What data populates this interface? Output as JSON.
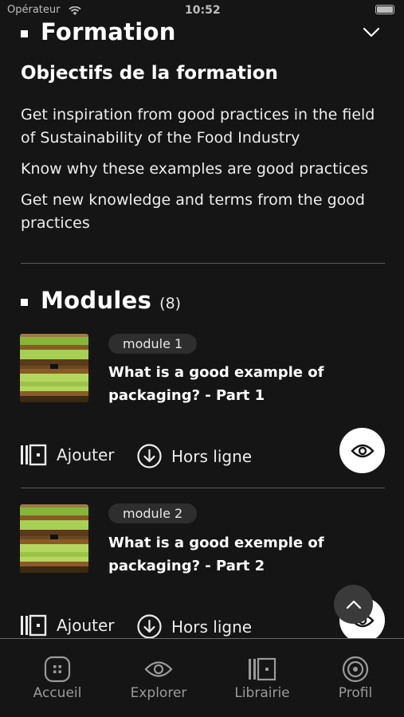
{
  "status_bar": {
    "carrier": "Opérateur",
    "time": "10:52"
  },
  "formation": {
    "title": "Formation",
    "objectives_title": "Objectifs de la formation",
    "objectives": [
      "Get inspiration from good practices in the field of Sustainability of the Food Industry",
      "Know why these examples are good practices",
      "Get new knowledge and terms from the good practices"
    ]
  },
  "modules": {
    "title": "Modules",
    "count": "(8)",
    "items": [
      {
        "badge": "module 1",
        "title": "What is a good example of packaging? - Part 1",
        "add_label": "Ajouter",
        "offline_label": "Hors ligne"
      },
      {
        "badge": "module 2",
        "title": "What is a good exemple of packaging? - Part 2",
        "add_label": "Ajouter",
        "offline_label": "Hors ligne"
      }
    ]
  },
  "tab_bar": {
    "items": [
      {
        "label": "Accueil",
        "icon": "home-grid-icon"
      },
      {
        "label": "Explorer",
        "icon": "eye-icon"
      },
      {
        "label": "Librairie",
        "icon": "library-icon"
      },
      {
        "label": "Profil",
        "icon": "profile-target-icon"
      }
    ]
  },
  "colors": {
    "background": "#151515",
    "text": "#ffffff",
    "muted": "#9a9a9a",
    "badge": "#2e2e2e",
    "divider": "#5a5a5a"
  }
}
